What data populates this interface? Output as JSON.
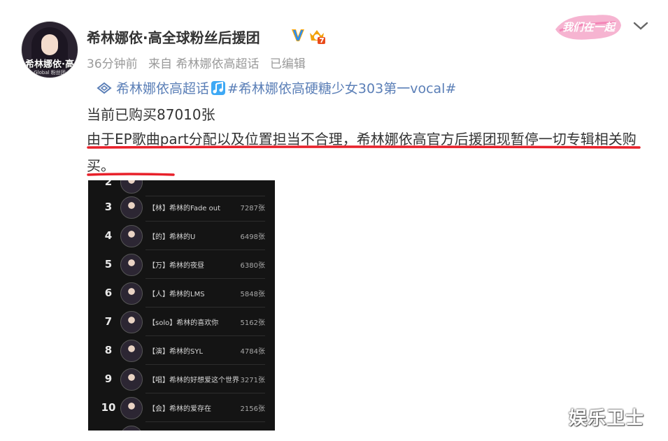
{
  "post": {
    "avatar_text": "希林娜依·高",
    "avatar_subtext": "Global 粉丝团",
    "username": "希林娜依·高全球粉丝后援团",
    "meta": {
      "time": "36分钟前",
      "source": "来自 希林娜依高超话",
      "edited": "已编辑"
    },
    "tags": {
      "supertopic": "希林娜依高超话",
      "hashtag": "#希林娜依高硬糖少女303第一vocal#"
    },
    "line1": "当前已购买87010张",
    "paragraph": "由于EP歌曲part分配以及位置担当不合理，希林娜依高官方后援团现暂停一切专辑相关购买。",
    "sticker_text": "我们在一起",
    "colors": {
      "link": "#5b7fb7",
      "underline": "#e8202a",
      "verify": "#ffa500"
    }
  },
  "leaderboard": {
    "rows": [
      {
        "rank": "2",
        "title": "",
        "count": ""
      },
      {
        "rank": "3",
        "title": "【林】希林的Fade out",
        "count": "7287张"
      },
      {
        "rank": "4",
        "title": "【的】希林的U",
        "count": "6498张"
      },
      {
        "rank": "5",
        "title": "【万】希林的夜昼",
        "count": "6380张"
      },
      {
        "rank": "6",
        "title": "【人】希林的LMS",
        "count": "5848张"
      },
      {
        "rank": "7",
        "title": "【solo】希林的喜欢你",
        "count": "5162张"
      },
      {
        "rank": "8",
        "title": "【演】希林的SYL",
        "count": "4784张"
      },
      {
        "rank": "9",
        "title": "【唱】希林的好想爱这个世界",
        "count": "3271张"
      },
      {
        "rank": "10",
        "title": "【会】希林的爱存在",
        "count": "2156张"
      }
    ]
  },
  "watermark": "娱乐卫士",
  "icons": {
    "verify": "verified-v-icon",
    "badge": "crown-badge-icon",
    "more": "chevron-down-icon",
    "supertopic": "supertopic-ring-icon",
    "music": "music-note-icon"
  }
}
